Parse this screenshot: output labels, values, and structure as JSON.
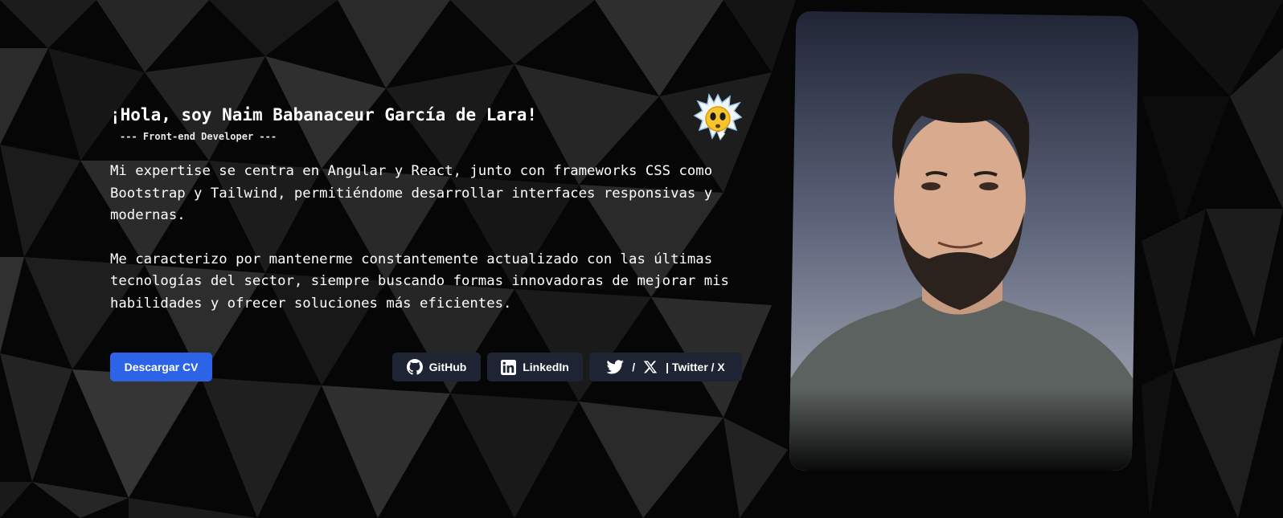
{
  "intro": {
    "greeting": "¡Hola, soy Naim Babanaceur García de Lara!",
    "role": "--- Front-end Developer ---",
    "bio_paragraph_1": "Mi expertise se centra en Angular y React, junto con frameworks CSS como Bootstrap y Tailwind, permitiéndome desarrollar interfaces responsivas y modernas.",
    "bio_paragraph_2": "Me caracterizo por mantenerme constantemente actualizado con las últimas tecnologías del sector, siempre buscando formas innovadoras de mejorar mis habilidades y ofrecer soluciones más eficientes.",
    "decoration_icon": "exploding-head-emoji-icon"
  },
  "actions": {
    "download_cv_label": "Descargar CV",
    "github_label": "GitHub",
    "github_icon": "github-icon",
    "linkedin_label": "LinkedIn",
    "linkedin_icon": "linkedin-icon",
    "twitter_icons": [
      "twitter-bird-icon",
      "x-logo-icon"
    ],
    "twitter_separator": "/",
    "twitter_label": "| Twitter / X"
  },
  "colors": {
    "background": "#050505",
    "primary_button": "#2d63e6",
    "social_button": "#1e2433",
    "text": "#ffffff"
  },
  "photo": {
    "description_icon": "profile-photo"
  }
}
